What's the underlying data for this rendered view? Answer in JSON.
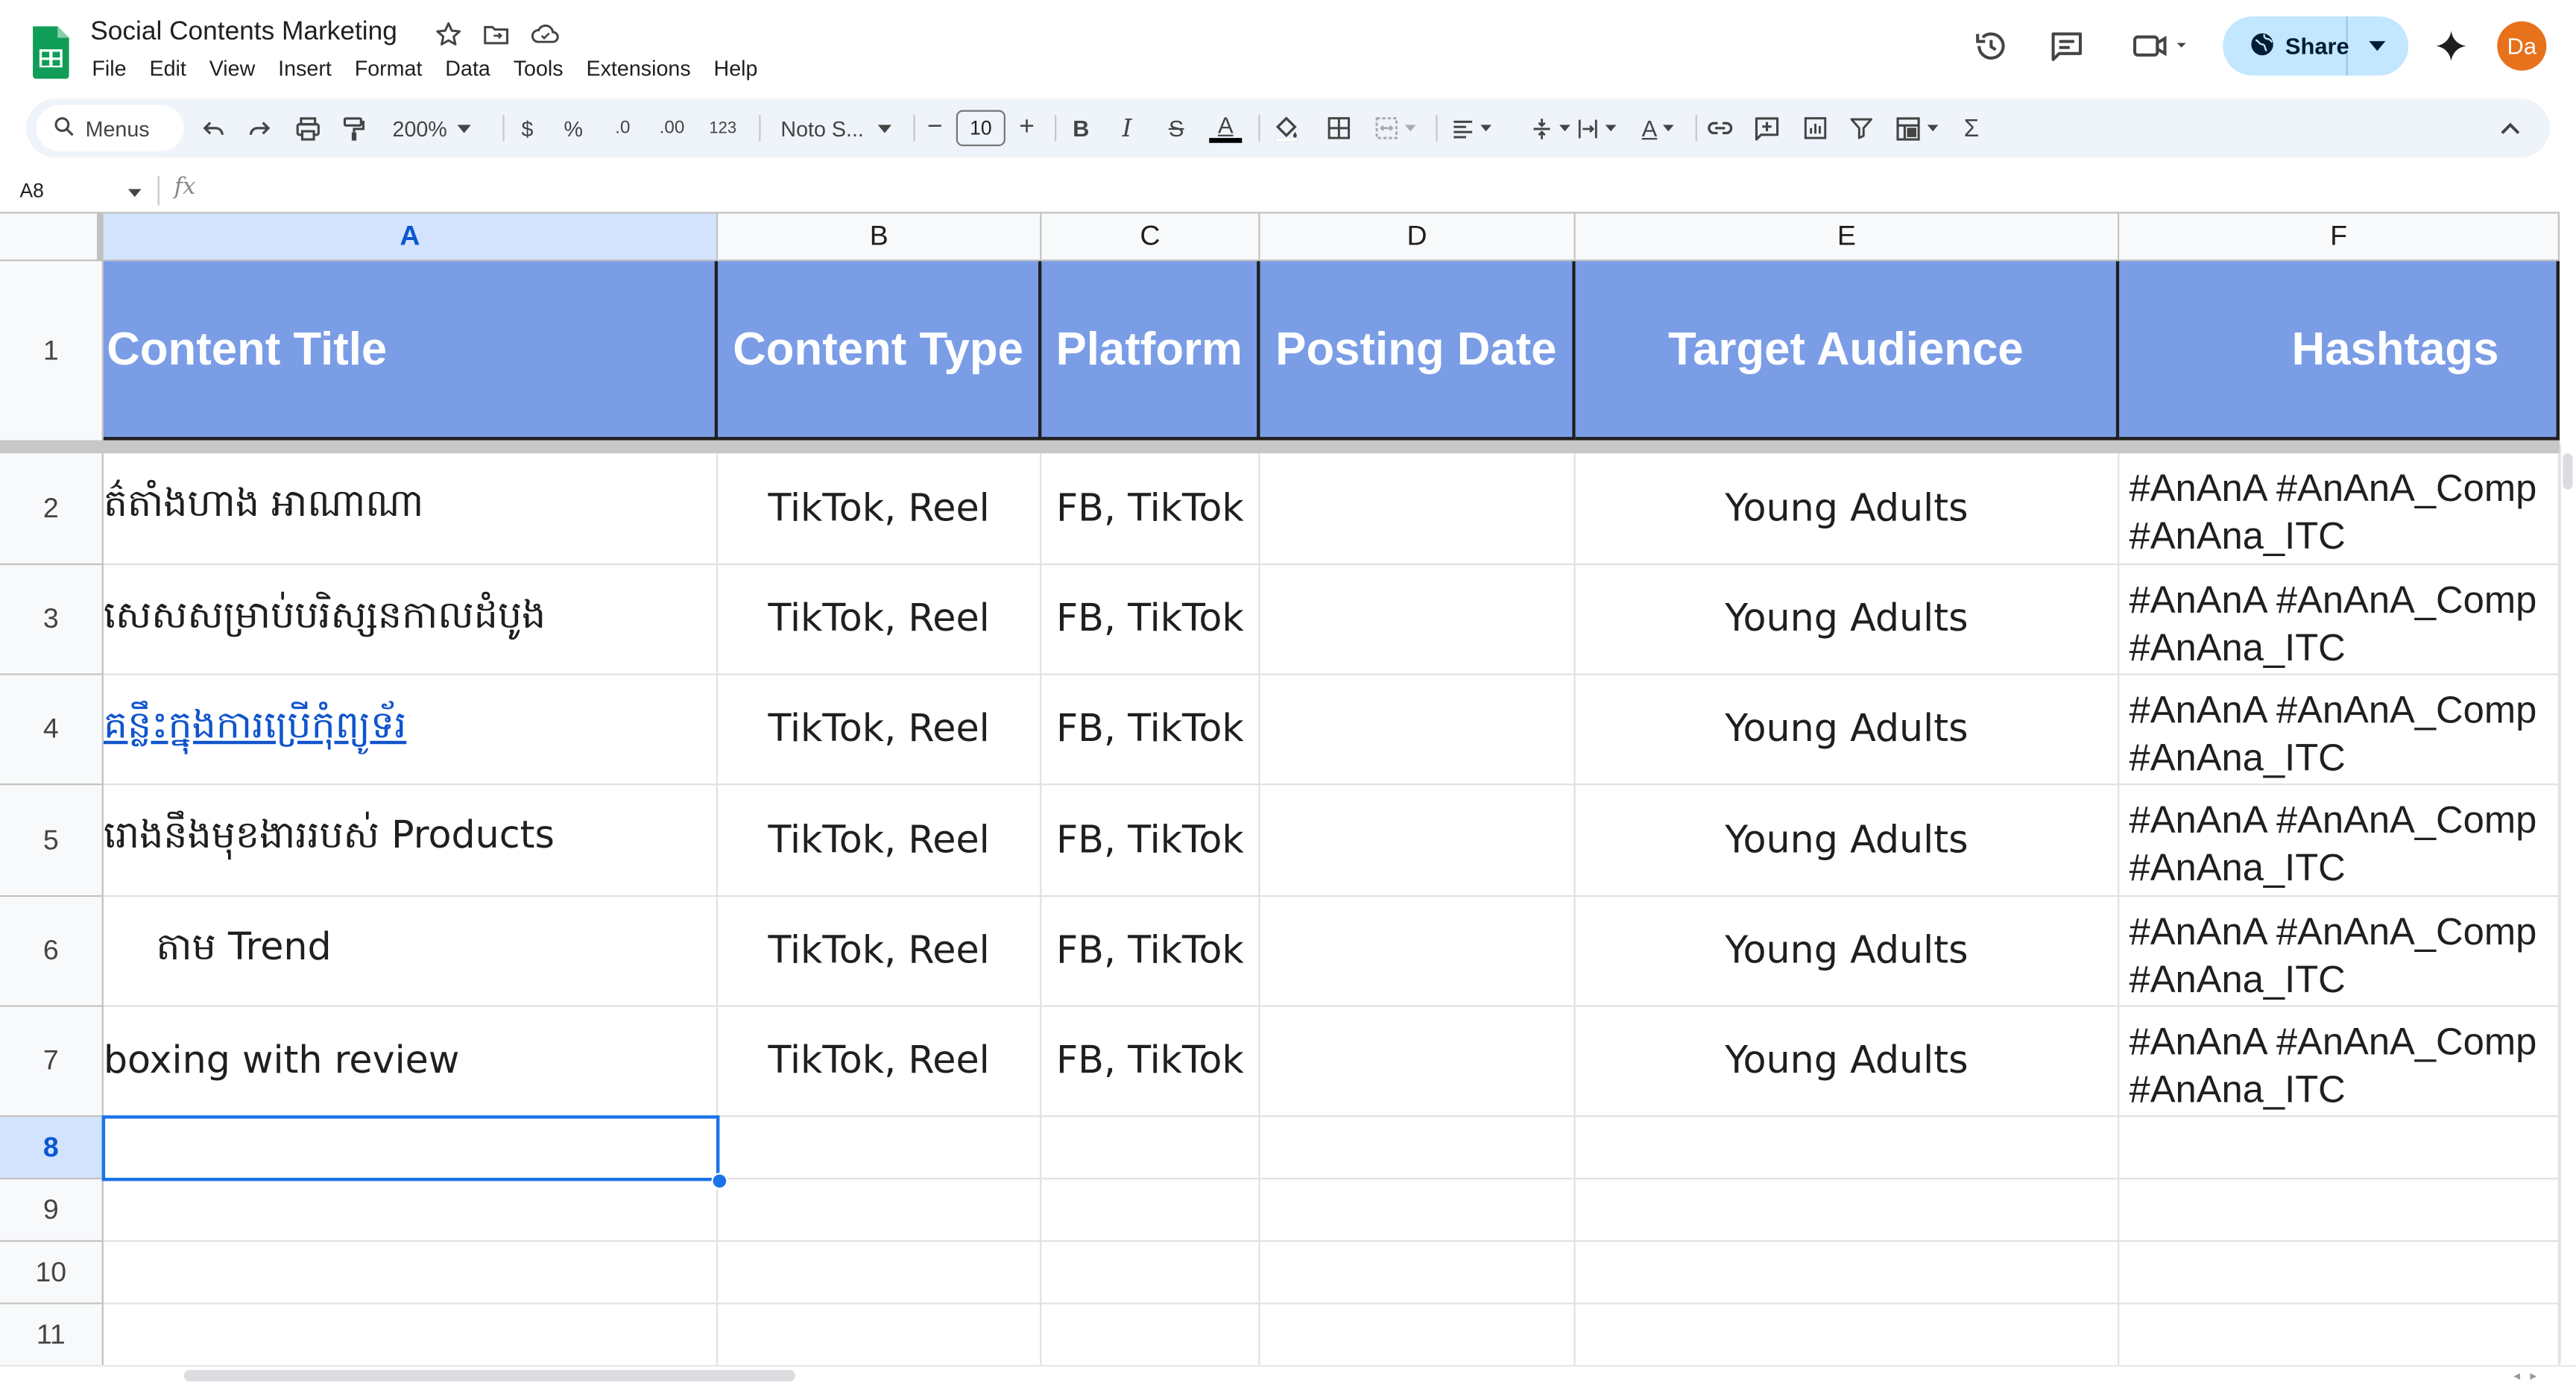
{
  "app": {
    "doc_title": "Social Contents Marketing",
    "menu": [
      "File",
      "Edit",
      "View",
      "Insert",
      "Format",
      "Data",
      "Tools",
      "Extensions",
      "Help"
    ],
    "share_label": "Share",
    "avatar_initials": "Da"
  },
  "toolbar": {
    "search_label": "Menus",
    "zoom": "200%",
    "currency": "$",
    "percent": "%",
    "dec_decrease": ".0",
    "dec_increase": ".00",
    "number_format": "123",
    "font": "Noto S...",
    "font_size": "10",
    "minus": "−",
    "plus": "+",
    "bold": "B",
    "italic": "I",
    "strike": "S",
    "text_color": "A",
    "text_rotation": "A",
    "functions": "Σ"
  },
  "formula_bar": {
    "cell_ref": "A8",
    "fx": "fx",
    "value": ""
  },
  "grid": {
    "columns": [
      "A",
      "B",
      "C",
      "D",
      "E",
      "F"
    ],
    "row_numbers": [
      "1",
      "2",
      "3",
      "4",
      "5",
      "6",
      "7",
      "8",
      "9",
      "10",
      "11"
    ],
    "headers": [
      "Content Title",
      "Content Type",
      "Platform",
      "Posting Date",
      "Target Audience",
      "Hashtags"
    ],
    "rows": [
      {
        "title": "ត៌តាំងហាង អាណាណា",
        "type": "TikTok, Reel",
        "platform": "FB, TikTok",
        "date": "",
        "audience": "Young Adults",
        "hashtags": "#AnAnA #AnAnA_Comp #AnAna_ITC"
      },
      {
        "title": "សេសសម្រាប់បរិស្សនកាលដំបូង",
        "type": "TikTok, Reel",
        "platform": "FB, TikTok",
        "date": "",
        "audience": "Young Adults",
        "hashtags": "#AnAnA #AnAnA_Comp #AnAna_ITC"
      },
      {
        "title": "គន្លឹះក្នុងការប្រើកុំព្យូទ័រ",
        "type": "TikTok, Reel",
        "platform": "FB, TikTok",
        "date": "",
        "audience": "Young Adults",
        "hashtags": "#AnAnA #AnAnA_Comp #AnAna_ITC"
      },
      {
        "title": "រោងនឹងមុខងាររបស់ Products",
        "type": "TikTok, Reel",
        "platform": "FB, TikTok",
        "date": "",
        "audience": "Young Adults",
        "hashtags": "#AnAnA #AnAnA_Comp #AnAna_ITC"
      },
      {
        "title": "តាម Trend",
        "type": "TikTok, Reel",
        "platform": "FB, TikTok",
        "date": "",
        "audience": "Young Adults",
        "hashtags": "#AnAnA #AnAnA_Comp #AnAna_ITC"
      },
      {
        "title": "boxing with review",
        "type": "TikTok, Reel",
        "platform": "FB, TikTok",
        "date": "",
        "audience": "Young Adults",
        "hashtags": "#AnAnA #AnAnA_Comp #AnAna_ITC"
      }
    ],
    "link_color": "#1155cc",
    "header_fill": "#7a9de6",
    "selection_color": "#1a73e8"
  }
}
